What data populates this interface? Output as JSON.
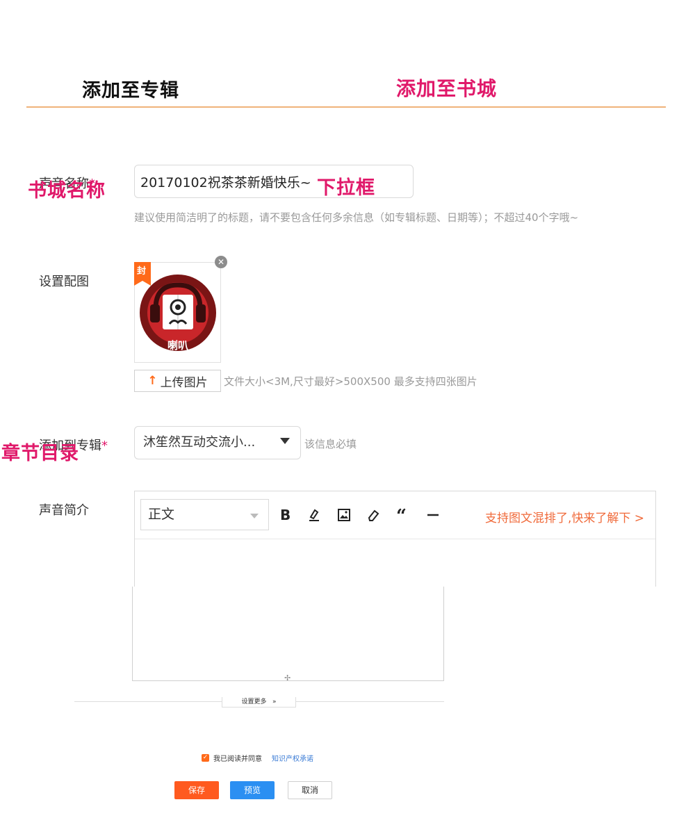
{
  "header": {
    "title": "添加至专辑",
    "annotation_title": "添加至书城"
  },
  "form": {
    "name_label": "声音名称",
    "required_mark": "*",
    "name_value": "20170102祝茶茶新婚快乐~",
    "name_hint": "建议使用简洁明了的标题，请不要包含任何多余信息（如专辑标题、日期等）；不超过40个字哦~",
    "annotation_name": "书城名称",
    "annotation_dropdown": "下拉框",
    "image_label": "设置配图",
    "cover_tag": "封",
    "upload_label": "上传图片",
    "upload_hint": "文件大小<3M,尺寸最好>500X500 最多支持四张图片",
    "album_label": "添加到专辑",
    "album_value": "沐笙然互动交流小...",
    "album_required": "该信息必填",
    "annotation_chapter": "章节目录",
    "intro_label": "声音简介"
  },
  "editor": {
    "style_value": "正文",
    "promo": "支持图文混排了,快来了解下 >",
    "more": "设置更多"
  },
  "footer": {
    "agree_text": "我已阅读并同意",
    "agree_link": "知识产权承诺",
    "save": "保存",
    "preview": "预览",
    "cancel": "取消"
  },
  "icons": {
    "editor_toolbar": [
      "bold-icon",
      "text-highlight-icon",
      "insert-image-icon",
      "eraser-icon",
      "quote-icon",
      "horizontal-rule-icon"
    ]
  },
  "colors": {
    "accent": "#ff5a1f",
    "annotation": "#e0196a",
    "link": "#3a7bd5",
    "preview": "#2b8ff2"
  }
}
